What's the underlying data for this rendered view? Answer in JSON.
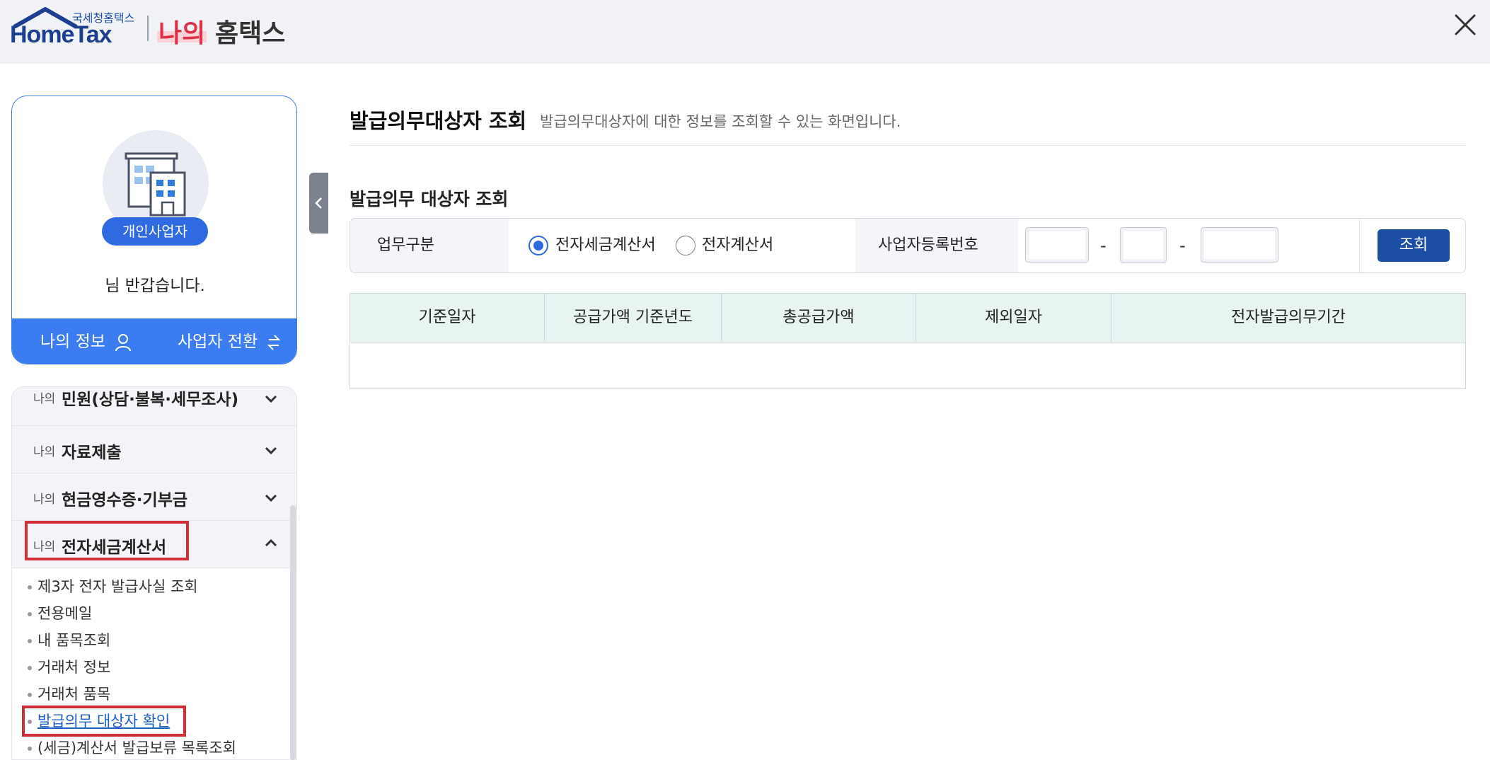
{
  "header": {
    "logo_small": "국세청홈택스",
    "logo_big": "HomeTax",
    "brand_na": "나의",
    "brand_hometax": "홈택스"
  },
  "profile": {
    "badge": "개인사업자",
    "greeting": "님 반갑습니다.",
    "my_info": "나의 정보",
    "switch_business": "사업자 전환"
  },
  "sidebar": {
    "menu": [
      {
        "prefix": "나의",
        "label": "민원(상담·불복·세무조사)",
        "expanded": false
      },
      {
        "prefix": "나의",
        "label": "자료제출",
        "expanded": false
      },
      {
        "prefix": "나의",
        "label": "현금영수증·기부금",
        "expanded": false
      },
      {
        "prefix": "나의",
        "label": "전자세금계산서",
        "expanded": true
      }
    ],
    "sub_items": [
      "제3자 전자 발급사실 조회",
      "전용메일",
      "내 품목조회",
      "거래처 정보",
      "거래처 품목",
      "발급의무 대상자 확인",
      "(세금)계산서 발급보류 목록조회"
    ]
  },
  "main": {
    "title": "발급의무대상자 조회",
    "description": "발급의무대상자에 대한 정보를 조회할 수 있는 화면입니다.",
    "section_title": "발급의무 대상자 조회",
    "search": {
      "work_type_label": "업무구분",
      "radio_options": [
        "전자세금계산서",
        "전자계산서"
      ],
      "selected": "전자세금계산서",
      "biz_no_label": "사업자등록번호",
      "separator": "-",
      "button": "조회"
    },
    "table": {
      "columns": [
        "기준일자",
        "공급가액 기준년도",
        "총공급가액",
        "제외일자",
        "전자발급의무기간"
      ],
      "rows": []
    }
  },
  "colors": {
    "primary": "#3b7cf0",
    "navy": "#1c4fa3",
    "highlight_red": "#d32f3a",
    "table_header": "#e8f4f2"
  }
}
